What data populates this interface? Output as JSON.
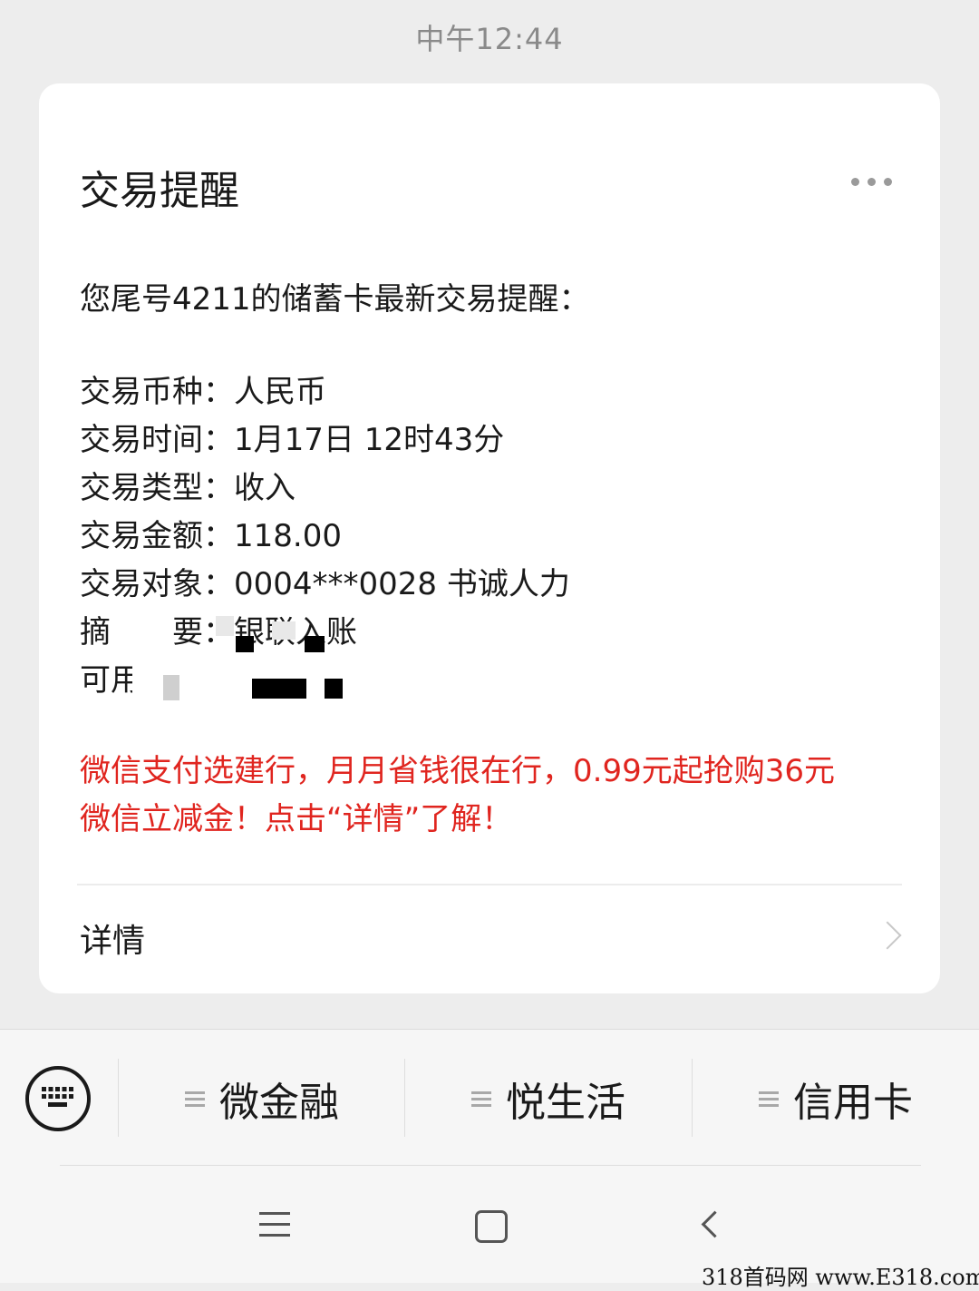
{
  "status": {
    "timestamp": "中午12:44"
  },
  "card": {
    "title": "交易提醒",
    "more_icon": "more-horizontal-icon",
    "intro": "您尾号4211的储蓄卡最新交易提醒：",
    "fields": [
      {
        "label": "交易币种",
        "value": "人民币"
      },
      {
        "label": "交易时间",
        "value": "1月17日 12时43分"
      },
      {
        "label": "交易类型",
        "value": "收入"
      },
      {
        "label": "交易金额",
        "value": "118.00"
      },
      {
        "label": "交易对象",
        "value": "0004***0028 书诚人力"
      },
      {
        "label": "摘　　要",
        "value": "银联入账"
      },
      {
        "label": "可用余额",
        "value": ""
      }
    ],
    "promo_line1": "微信支付选建行，月月省钱很在行，0.99元起抢购36元",
    "promo_line2": "微信立减金！点击“详情”了解！",
    "promo_color": "#e0251f",
    "details_label": "详情"
  },
  "menu": {
    "keyboard_icon": "keyboard-icon",
    "items": [
      {
        "label": "微金融",
        "icon": "menu-lines-icon"
      },
      {
        "label": "悦生活",
        "icon": "menu-lines-icon"
      },
      {
        "label": "信用卡",
        "icon": "menu-lines-icon"
      }
    ]
  },
  "navbar": {
    "icons": [
      "menu-icon",
      "home-icon",
      "back-icon"
    ]
  },
  "watermark": "318首码网  www.E318.com"
}
